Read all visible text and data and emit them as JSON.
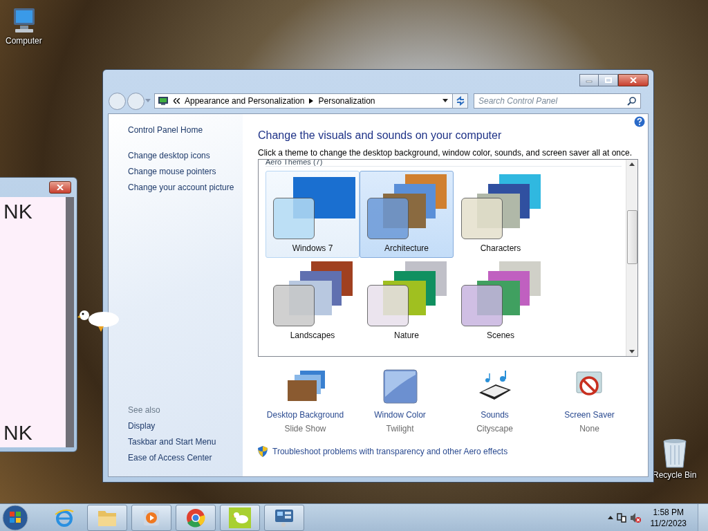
{
  "desktop_icons": [
    {
      "kind": "computer",
      "label": "Computer"
    },
    {
      "kind": "recycle-bin",
      "label": "Recycle Bin"
    }
  ],
  "side_window": {
    "lines": [
      "NK",
      "NK"
    ]
  },
  "window": {
    "address": {
      "path": [
        "Appearance and Personalization",
        "Personalization"
      ]
    },
    "search": {
      "placeholder": "Search Control Panel"
    },
    "sidebar": {
      "home": "Control Panel Home",
      "links": [
        "Change desktop icons",
        "Change mouse pointers",
        "Change your account picture"
      ],
      "see_also_title": "See also",
      "see_also": [
        "Display",
        "Taskbar and Start Menu",
        "Ease of Access Center"
      ]
    },
    "heading": "Change the visuals and sounds on your computer",
    "description": "Click a theme to change the desktop background, window color, sounds, and screen saver all at once.",
    "themes": {
      "group": "Aero Themes (7)",
      "items": [
        {
          "name": "Windows 7",
          "selected": false,
          "hovered": true,
          "color": "#b4dcf4"
        },
        {
          "name": "Architecture",
          "selected": true,
          "hovered": false,
          "color": "#6c9ad8"
        },
        {
          "name": "Characters",
          "selected": false,
          "hovered": false,
          "color": "#e4e0cc"
        },
        {
          "name": "Landscapes",
          "selected": false,
          "hovered": false,
          "color": "#c8c8c8"
        },
        {
          "name": "Nature",
          "selected": false,
          "hovered": false,
          "color": "#e8e0ec"
        },
        {
          "name": "Scenes",
          "selected": false,
          "hovered": false,
          "color": "#c8b4e0"
        }
      ]
    },
    "settings": [
      {
        "kind": "background",
        "label": "Desktop Background",
        "value": "Slide Show"
      },
      {
        "kind": "color",
        "label": "Window Color",
        "value": "Twilight"
      },
      {
        "kind": "sounds",
        "label": "Sounds",
        "value": "Cityscape"
      },
      {
        "kind": "screensaver",
        "label": "Screen Saver",
        "value": "None"
      }
    ],
    "troubleshoot_link": "Troubleshoot problems with transparency and other Aero effects"
  },
  "taskbar": {
    "buttons": [
      {
        "kind": "browser",
        "running": false
      },
      {
        "kind": "folder",
        "running": true
      },
      {
        "kind": "media",
        "running": true
      },
      {
        "kind": "chrome",
        "running": true
      },
      {
        "kind": "duck",
        "running": true
      },
      {
        "kind": "control-panel",
        "running": true
      }
    ],
    "clock": {
      "time": "1:58 PM",
      "date": "11/2/2023"
    }
  }
}
